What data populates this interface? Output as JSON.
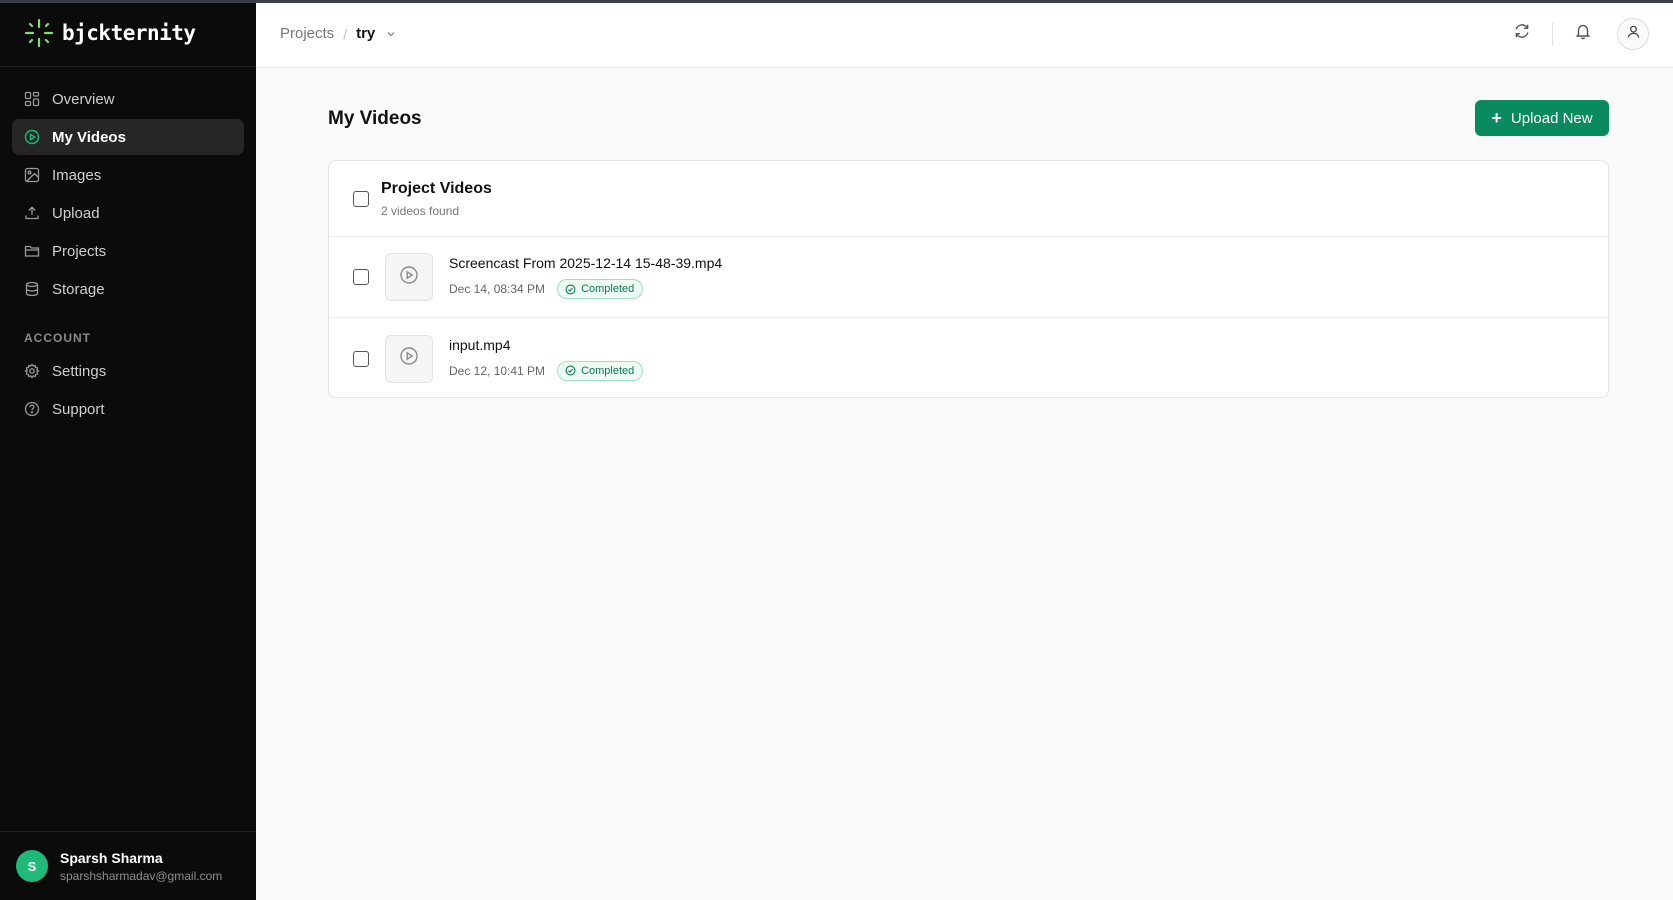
{
  "brand": {
    "name": "bjckternity"
  },
  "sidebar": {
    "items": [
      {
        "label": "Overview",
        "icon": "grid-icon"
      },
      {
        "label": "My Videos",
        "icon": "play-circle-icon",
        "active": true
      },
      {
        "label": "Images",
        "icon": "image-icon"
      },
      {
        "label": "Upload",
        "icon": "upload-icon"
      },
      {
        "label": "Projects",
        "icon": "folder-icon"
      },
      {
        "label": "Storage",
        "icon": "database-icon"
      }
    ],
    "account_label": "ACCOUNT",
    "account_items": [
      {
        "label": "Settings",
        "icon": "gear-icon"
      },
      {
        "label": "Support",
        "icon": "help-circle-icon"
      }
    ],
    "user": {
      "initial": "S",
      "name": "Sparsh Sharma",
      "email": "sparshsharmadav@gmail.com"
    }
  },
  "header": {
    "breadcrumb_root": "Projects",
    "breadcrumb_sep": "/",
    "breadcrumb_current": "try"
  },
  "main": {
    "title": "My Videos",
    "upload_label": "Upload New",
    "panel": {
      "title": "Project Videos",
      "subtitle": "2 videos found",
      "videos": [
        {
          "name": "Screencast From 2025-12-14 15-48-39.mp4",
          "date": "Dec 14, 08:34 PM",
          "status": "Completed"
        },
        {
          "name": "input.mp4",
          "date": "Dec 12, 10:41 PM",
          "status": "Completed"
        }
      ]
    }
  },
  "colors": {
    "accent": "#0a8a5f",
    "sidebar_bg": "#0b0b0b",
    "brand_mark": "#7ee36a",
    "status_completed": "#0c7a53"
  }
}
